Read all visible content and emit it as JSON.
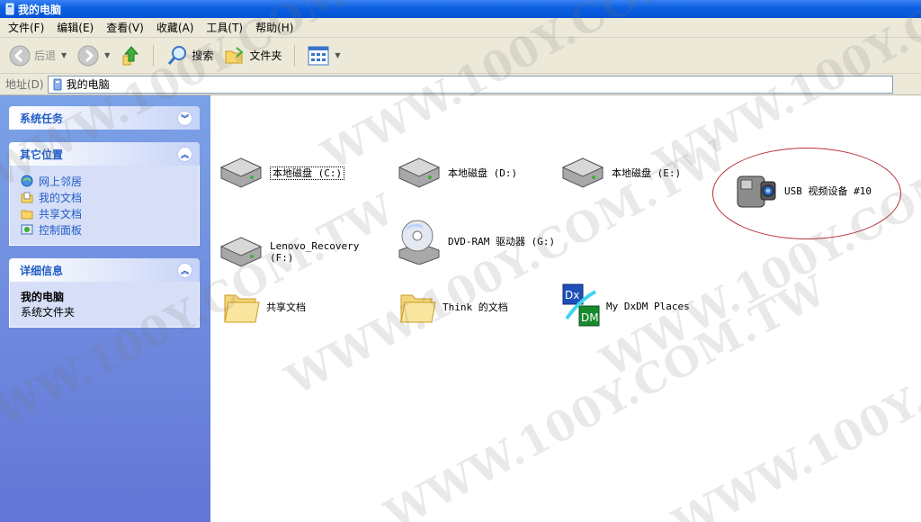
{
  "window": {
    "title": "我的电脑"
  },
  "menu": [
    "文件(F)",
    "编辑(E)",
    "查看(V)",
    "收藏(A)",
    "工具(T)",
    "帮助(H)"
  ],
  "toolbar": {
    "back": "后退",
    "search": "搜索",
    "folders": "文件夹"
  },
  "address": {
    "label": "地址(D)",
    "value": "我的电脑"
  },
  "left_pane": {
    "system_tasks": {
      "title": "系统任务"
    },
    "other_places": {
      "title": "其它位置",
      "links": [
        "网上邻居",
        "我的文档",
        "共享文档",
        "控制面板"
      ]
    },
    "details": {
      "title": "详细信息",
      "name": "我的电脑",
      "type": "系统文件夹"
    }
  },
  "items": {
    "drive_c": "本地磁盘 (C:)",
    "drive_d": "本地磁盘 (D:)",
    "drive_e": "本地磁盘 (E:)",
    "usb_video": "USB 视频设备 #10",
    "recovery": "Lenovo_Recovery",
    "recovery_letter": "(F:)",
    "dvd": "DVD-RAM 驱动器 (G:)",
    "shared": "共享文档",
    "think_docs": "Think 的文档",
    "dxdm": "My DxDM Places",
    "dxdm_icon_top": "Dx",
    "dxdm_icon_bottom": "DM"
  },
  "watermark": {
    "text": "WWW.100Y.COM.TW"
  },
  "colors": {
    "title_bar": "#0553d6",
    "left_pane": "#6d8fe0",
    "link": "#215dc6",
    "highlight": "#b9323a"
  }
}
